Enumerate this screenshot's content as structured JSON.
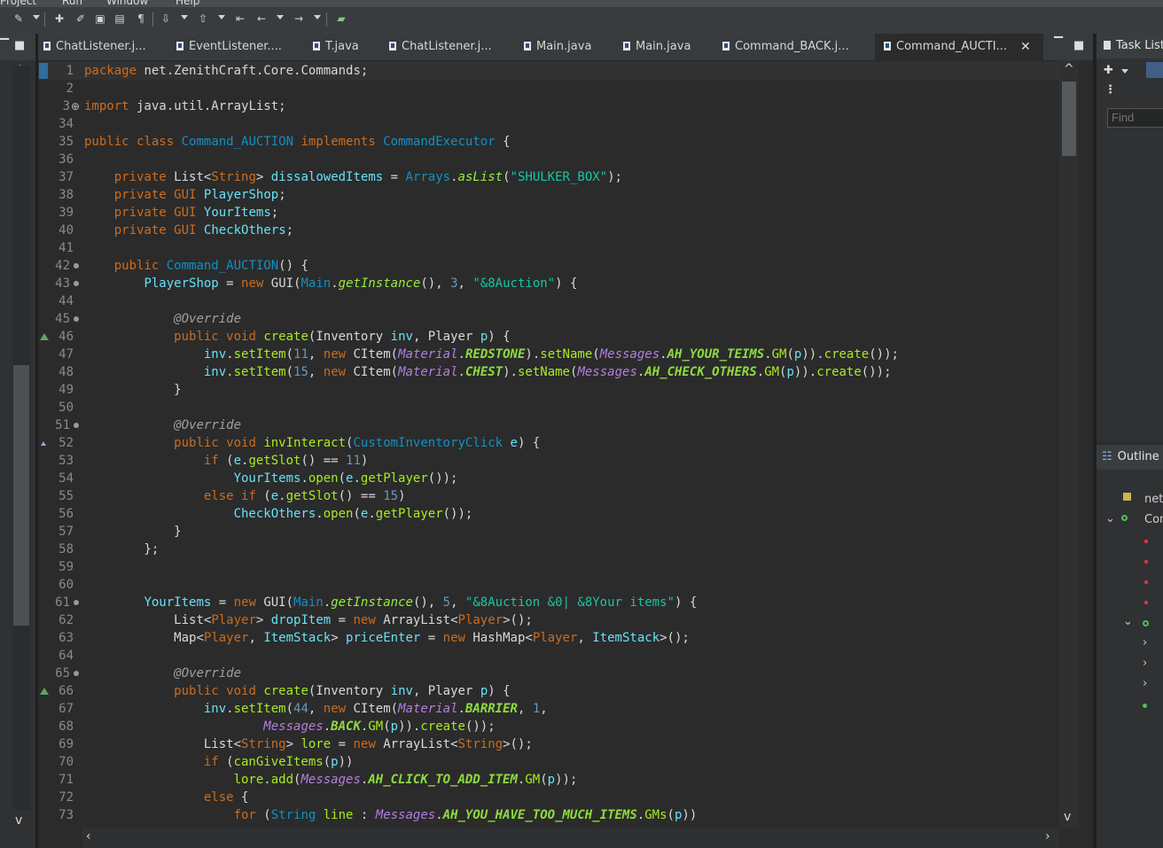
{
  "menu": {
    "items": [
      "Project",
      "Run",
      "Window",
      "Help"
    ]
  },
  "toolbar": {
    "icons": [
      "brush-icon",
      "new-icon",
      "pencil-icon",
      "save-icon",
      "layout-icon",
      "pilcrow-icon",
      "next-annotation-icon",
      "prev-annotation-icon",
      "back-icon",
      "forward-icon",
      "open-task-icon"
    ]
  },
  "tabs": [
    {
      "label": "ChatListener.j..."
    },
    {
      "label": "EventListener...."
    },
    {
      "label": "T.java"
    },
    {
      "label": "ChatListener.j..."
    },
    {
      "label": "Main.java"
    },
    {
      "label": "Main.java"
    },
    {
      "label": "Command_BACK.j..."
    },
    {
      "label": "Command_AUCTI...",
      "active": true
    }
  ],
  "tab_close": "✕",
  "editor": {
    "lines": [
      {
        "n": "1"
      },
      {
        "n": "2"
      },
      {
        "n": "3"
      },
      {
        "n": "34"
      },
      {
        "n": "35"
      },
      {
        "n": "36"
      },
      {
        "n": "37"
      },
      {
        "n": "38"
      },
      {
        "n": "39"
      },
      {
        "n": "40"
      },
      {
        "n": "41"
      },
      {
        "n": "42"
      },
      {
        "n": "43"
      },
      {
        "n": "44"
      },
      {
        "n": "45"
      },
      {
        "n": "46"
      },
      {
        "n": "47"
      },
      {
        "n": "48"
      },
      {
        "n": "49"
      },
      {
        "n": "50"
      },
      {
        "n": "51"
      },
      {
        "n": "52"
      },
      {
        "n": "53"
      },
      {
        "n": "54"
      },
      {
        "n": "55"
      },
      {
        "n": "56"
      },
      {
        "n": "57"
      },
      {
        "n": "58"
      },
      {
        "n": "59"
      },
      {
        "n": "60"
      },
      {
        "n": "61"
      },
      {
        "n": "62"
      },
      {
        "n": "63"
      },
      {
        "n": "64"
      },
      {
        "n": "65"
      },
      {
        "n": "66"
      },
      {
        "n": "67"
      },
      {
        "n": "68"
      },
      {
        "n": "69"
      },
      {
        "n": "70"
      },
      {
        "n": "71"
      },
      {
        "n": "72"
      },
      {
        "n": "73"
      }
    ],
    "tokens": {
      "package_kw": "package",
      "package_name": " net.ZenithCraft.Core.Commands;",
      "import_kw": "import",
      "import_name": " java.util.ArrayList;",
      "public": "public",
      "class": "class",
      "class_name": "Command_AUCTION",
      "implements": "implements",
      "interface_name": "CommandExecutor",
      "private": "private",
      "new": "new",
      "void": "void",
      "if": "if",
      "else": "else",
      "for": "for",
      "override": "@Override",
      "List": "List",
      "String": "String",
      "Player": "Player",
      "Map": "Map",
      "ItemStack": "ItemStack",
      "ArrayList": "ArrayList",
      "HashMap": "HashMap",
      "GUI": "GUI",
      "Inventory": "Inventory",
      "CItem": "CItem",
      "CustomInventoryClick": "CustomInventoryClick",
      "Arrays": "Arrays",
      "asList": "asList",
      "Main": "Main",
      "getInstance": "getInstance",
      "Material": "Material",
      "Messages": "Messages",
      "REDSTONE": "REDSTONE",
      "CHEST": "CHEST",
      "BARRIER": "BARRIER",
      "BACK": "BACK",
      "AH_YOUR_TEIMS": "AH_YOUR_TEIMS",
      "AH_CHECK_OTHERS": "AH_CHECK_OTHERS",
      "AH_CLICK_TO_ADD_ITEM": "AH_CLICK_TO_ADD_ITEM",
      "AH_YOU_HAVE_TOO_MUCH_ITEMS": "AH_YOU_HAVE_TOO_MUCH_ITEMS",
      "dissalowedItems": "dissalowedItems",
      "PlayerShop": "PlayerShop",
      "YourItems": "YourItems",
      "CheckOthers": "CheckOthers",
      "dropItem": "dropItem",
      "priceEnter": "priceEnter",
      "lore": "lore",
      "inv": "inv",
      "p": "p",
      "e": "e",
      "line": "line",
      "create": "create",
      "invInteract": "invInteract",
      "setItem": "setItem",
      "setName": "setName",
      "GM": "GM",
      "GMs": "GMs",
      "getSlot": "getSlot",
      "open": "open",
      "getPlayer": "getPlayer",
      "add": "add",
      "canGiveItems": "canGiveItems",
      "str_shulker": "\"SHULKER_BOX\"",
      "str_auction": "\"&8Auction\"",
      "str_your_items": "\"&8Auction &0| &8Your items\"",
      "n1": "1",
      "n3": "3",
      "n5": "5",
      "n11": "11",
      "n15": "15",
      "n44": "44"
    }
  },
  "right_panels": {
    "task_title": "Task List",
    "find_placeholder": "Find",
    "outline_title": "Outline",
    "outline_items": [
      "net",
      "Com"
    ]
  }
}
